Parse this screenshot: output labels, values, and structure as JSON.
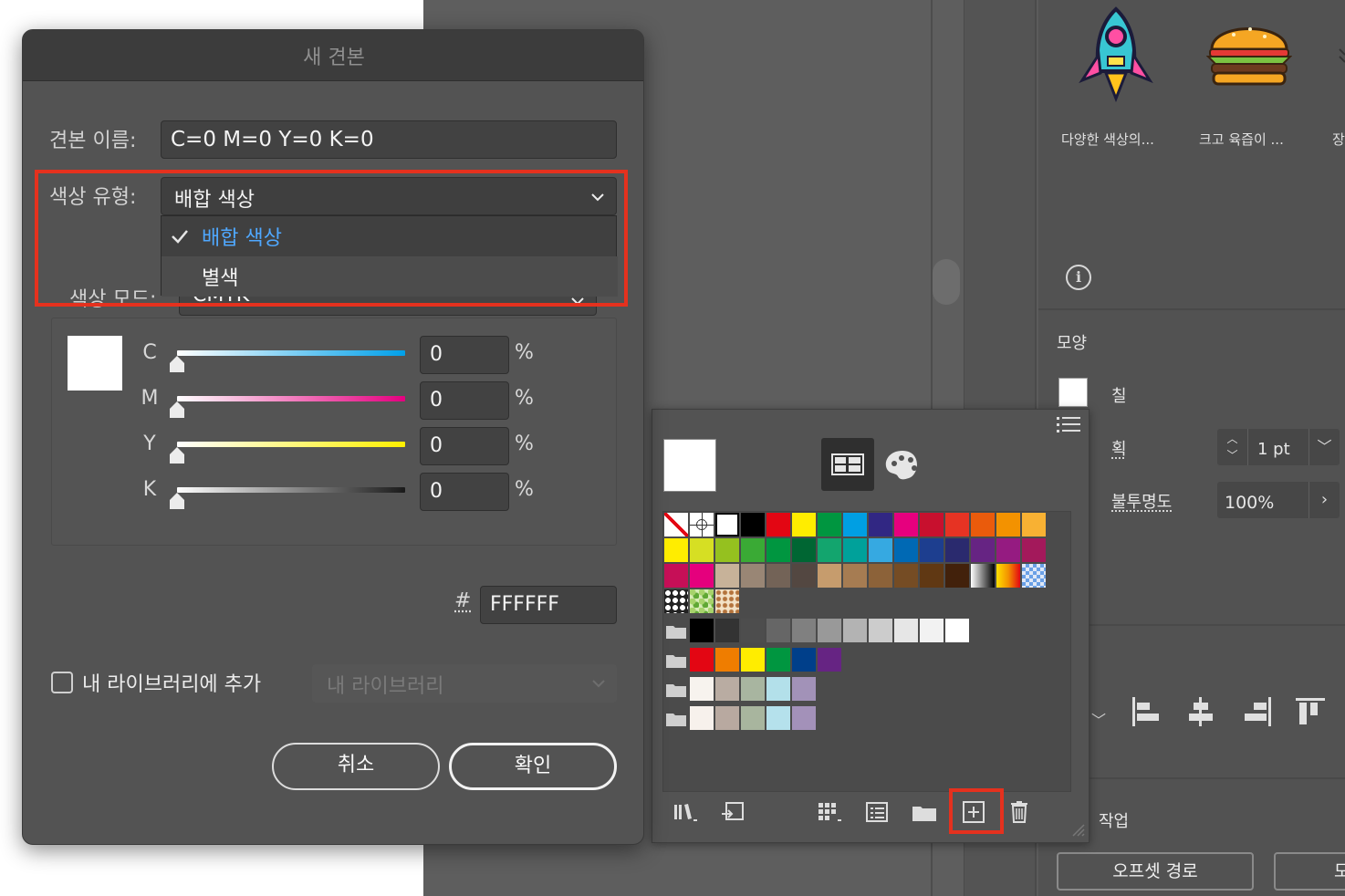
{
  "dialog": {
    "title": "새 견본",
    "swatch_name_label": "견본 이름:",
    "swatch_name_value": "C=0 M=0 Y=0 K=0",
    "color_type_label": "색상 유형:",
    "color_type_selected": "배합 색상",
    "color_type_options": [
      "배합 색상",
      "별색"
    ],
    "color_mode_label": "색상 모드:",
    "color_mode_value": "CMYK",
    "channels": [
      {
        "label": "C",
        "value": "0",
        "unit": "%"
      },
      {
        "label": "M",
        "value": "0",
        "unit": "%"
      },
      {
        "label": "Y",
        "value": "0",
        "unit": "%"
      },
      {
        "label": "K",
        "value": "0",
        "unit": "%"
      }
    ],
    "hex_label": "#",
    "hex_value": "FFFFFF",
    "add_to_library_label": "내 라이브러리에 추가",
    "library_select_value": "내 라이브러리",
    "cancel_label": "취소",
    "ok_label": "확인"
  },
  "right_panel": {
    "library_items": [
      {
        "caption": "다양한 색상의...",
        "icon": "rocket-thumbnail"
      },
      {
        "caption": "크고 육즙이 ...",
        "icon": "burger-thumbnail"
      },
      {
        "caption": "장",
        "icon": "partial-thumbnail"
      }
    ],
    "appearance_title": "모양",
    "fill_label": "칠",
    "stroke_label": "획",
    "stroke_value": "1 pt",
    "opacity_label": "불투명도",
    "opacity_value": "100%",
    "actions_title": "작업",
    "offset_path_label": "오프셋 경로",
    "partial_button_label": "모"
  },
  "swatches_panel": {
    "icons": [
      "swatch-libraries-icon",
      "place-swatches-icon",
      "show-swatch-kinds-icon",
      "swatch-options-icon",
      "new-color-group-icon",
      "new-swatch-icon",
      "delete-swatch-icon"
    ],
    "row1": [
      "none",
      "registration",
      "white",
      "#000000",
      "#e30613",
      "#ffed00",
      "#009640",
      "#009fe3",
      "#312783",
      "#e6007e",
      "#c8102e",
      "#e63323",
      "#ea5b0c",
      "#f39200",
      "#f8b133"
    ],
    "row2": [
      "#ffed00",
      "#d6df23",
      "#95c11f",
      "#3aaa35",
      "#009640",
      "#006633",
      "#13a56e",
      "#00a19a",
      "#36a9e1",
      "#0069b4",
      "#1d3e8f",
      "#2a2a6e",
      "#662483",
      "#951b81",
      "#a3195b"
    ],
    "row3": [
      "#c60f57",
      "#e5007d",
      "#c7b299",
      "#998675",
      "#736357",
      "#534741",
      "#c69c6d",
      "#a67c52",
      "#8c6239",
      "#754c24",
      "#603813",
      "#42210b",
      "gradient-bw",
      "gradient-warm",
      "transparent-pattern"
    ],
    "row4": [
      "pattern-dots",
      "pattern-leaves",
      "pattern-swirl"
    ],
    "group_grays": [
      "#000000",
      "#333333",
      "#4d4d4d",
      "#666666",
      "#808080",
      "#999999",
      "#b3b3b3",
      "#cccccc",
      "#e6e6e6",
      "#f2f2f2",
      "#ffffff"
    ],
    "group_brights": [
      "#e30613",
      "#ef7d00",
      "#ffed00",
      "#009640",
      "#003f8a",
      "#662483"
    ],
    "group_pastels_1": [
      "#f7f3ee",
      "#b9aca2",
      "#a8b5a0",
      "#b3e0ea",
      "#a292b8"
    ],
    "group_pastels_2": [
      "#f7f1ec",
      "#b8a9a0",
      "#a8b59e",
      "#b5e1ec",
      "#a391b9"
    ]
  }
}
